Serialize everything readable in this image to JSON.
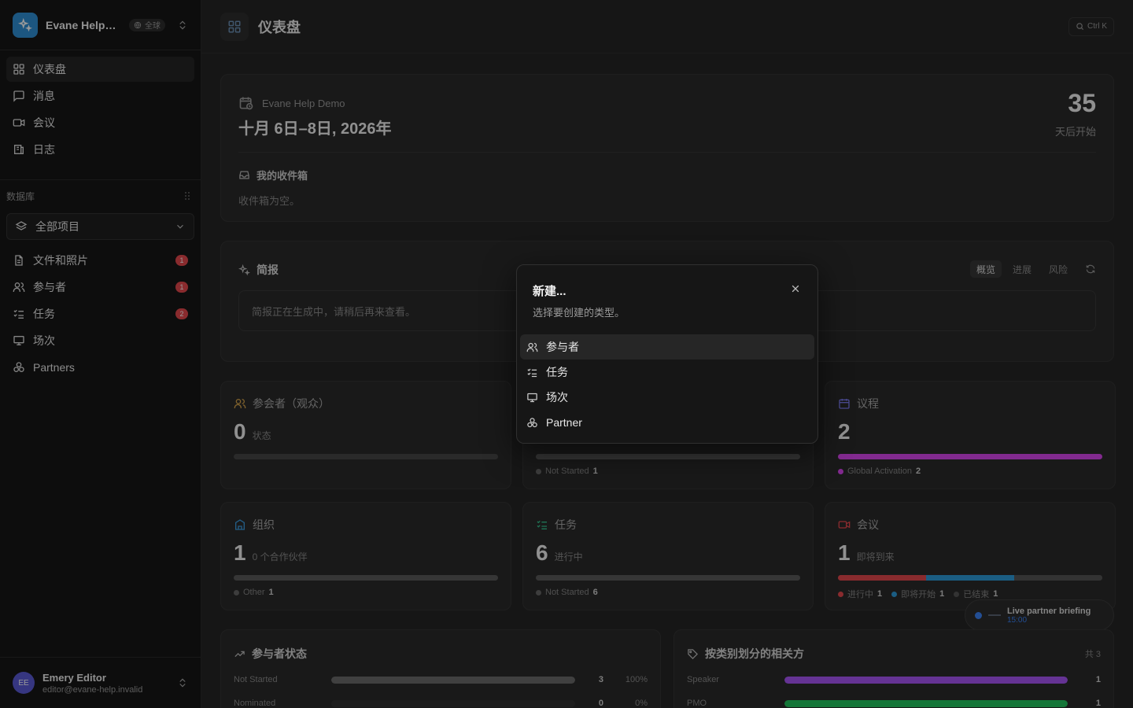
{
  "sidebar": {
    "workspace": {
      "name": "Evane Help Demo",
      "badge": "全球"
    },
    "nav": [
      {
        "label": "仪表盘",
        "icon": "dashboard-icon",
        "active": true
      },
      {
        "label": "消息",
        "icon": "message-icon"
      },
      {
        "label": "会议",
        "icon": "video-icon"
      },
      {
        "label": "日志",
        "icon": "log-icon"
      }
    ],
    "section_label": "数据库",
    "project_select": "全部项目",
    "db_items": [
      {
        "label": "文件和照片",
        "icon": "file-icon",
        "badge": "1"
      },
      {
        "label": "参与者",
        "icon": "users-icon",
        "badge": "1"
      },
      {
        "label": "任务",
        "icon": "tasks-icon",
        "badge": "2"
      },
      {
        "label": "场次",
        "icon": "session-icon"
      },
      {
        "label": "Partners",
        "icon": "partners-icon"
      }
    ],
    "user": {
      "initials": "EE",
      "name": "Emery Editor",
      "email": "editor@evane-help.invalid"
    }
  },
  "topbar": {
    "title": "仪表盘",
    "search_hint": "Ctrl K"
  },
  "hero": {
    "event_name": "Evane Help Demo",
    "dates": "十月 6日–8日, 2026年",
    "countdown": "35",
    "countdown_label": "天后开始",
    "inbox_title": "我的收件箱",
    "inbox_empty": "收件箱为空。"
  },
  "briefing": {
    "title": "简报",
    "tabs": [
      "概览",
      "进展",
      "风险"
    ],
    "message": "简报正在生成中，请稍后再来查看。"
  },
  "stats": {
    "attendees": {
      "title": "参会者（观众）",
      "value": "0",
      "unit": "状态"
    },
    "sessions": {
      "legend": "Not Started",
      "count": "1"
    },
    "agenda": {
      "title": "议程",
      "value": "2",
      "legend": "Global Activation",
      "count": "2"
    },
    "orgs": {
      "title": "组织",
      "value": "1",
      "unit": "0 个合作伙伴",
      "legend": "Other",
      "count": "1"
    },
    "tasks": {
      "title": "任务",
      "value": "6",
      "unit": "进行中",
      "legend": "Not Started",
      "count": "6"
    },
    "meetings": {
      "title": "会议",
      "value": "1",
      "unit": "即将到来",
      "legend": [
        {
          "label": "进行中",
          "count": "1",
          "color": "#e5484d",
          "share": 0.333
        },
        {
          "label": "即将开始",
          "count": "1",
          "color": "#2d9cdb",
          "share": 0.333
        },
        {
          "label": "已结束",
          "count": "1",
          "color": "#555555",
          "share": 0.334
        }
      ]
    }
  },
  "colors": {
    "agenda": "#d946ef",
    "bar_gray": "#5a5a5a",
    "accent_blue": "#2f8fd6"
  },
  "live": {
    "title": "Live partner briefing",
    "time": "15:00"
  },
  "attendee_status": {
    "title": "参与者状态",
    "rows": [
      {
        "label": "Not Started",
        "value": "3",
        "pct": "100%",
        "fill": 1.0
      },
      {
        "label": "Nominated",
        "value": "0",
        "pct": "0%",
        "fill": 0
      }
    ]
  },
  "stakeholders": {
    "title": "按类别划分的相关方",
    "count": "共 3",
    "rows": [
      {
        "label": "Speaker",
        "value": "1",
        "fill": 1.0,
        "color": "#a855f7"
      },
      {
        "label": "PMO",
        "value": "1",
        "fill": 1.0,
        "color": "#22c55e"
      }
    ]
  },
  "dialog": {
    "title": "新建...",
    "subtitle": "选择要创建的类型。",
    "items": [
      {
        "label": "参与者",
        "icon": "users-icon"
      },
      {
        "label": "任务",
        "icon": "tasks-icon"
      },
      {
        "label": "场次",
        "icon": "session-icon"
      },
      {
        "label": "Partner",
        "icon": "partners-icon"
      }
    ]
  }
}
